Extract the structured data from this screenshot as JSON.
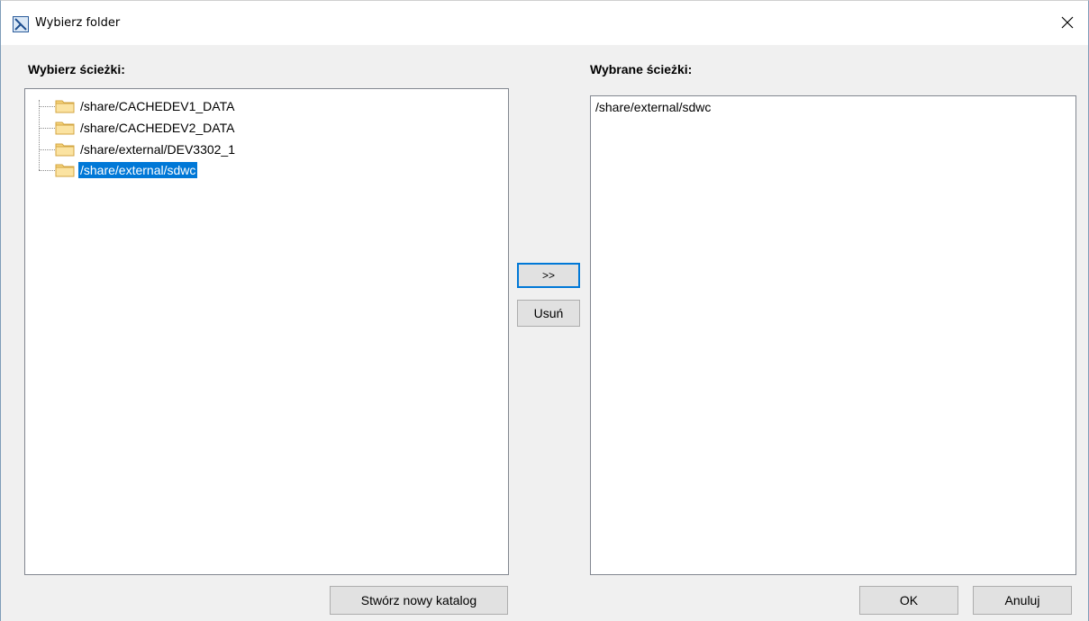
{
  "window": {
    "title": "Wybierz folder"
  },
  "left": {
    "label": "Wybierz ścieżki:",
    "tree": [
      {
        "label": "/share/CACHEDEV1_DATA",
        "icon": "folder-icon",
        "selected": false
      },
      {
        "label": "/share/CACHEDEV2_DATA",
        "icon": "folder-icon",
        "selected": false
      },
      {
        "label": "/share/external/DEV3302_1",
        "icon": "folder-icon",
        "selected": false
      },
      {
        "label": "/share/external/sdwc",
        "icon": "folder-icon",
        "selected": true
      }
    ],
    "create_button": "Stwórz nowy katalog"
  },
  "middle": {
    "add_button": ">>",
    "remove_button": "Usuń"
  },
  "right": {
    "label": "Wybrane ścieżki:",
    "items": [
      "/share/external/sdwc"
    ]
  },
  "footer": {
    "ok_button": "OK",
    "cancel_button": "Anuluj"
  },
  "colors": {
    "selection": "#0078d7",
    "panel_border": "#828790",
    "dialog_bg": "#f0f0f0"
  }
}
